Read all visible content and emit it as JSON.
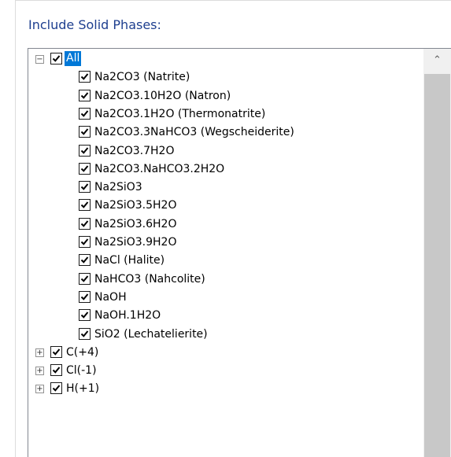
{
  "group": {
    "title": "Include Solid Phases:"
  },
  "tree": {
    "root": {
      "label": "All",
      "checked": true,
      "expanded": true,
      "selected": true
    },
    "children": [
      "Na2CO3 (Natrite)",
      "Na2CO3.10H2O (Natron)",
      "Na2CO3.1H2O (Thermonatrite)",
      "Na2CO3.3NaHCO3 (Wegscheiderite)",
      "Na2CO3.7H2O",
      "Na2CO3.NaHCO3.2H2O",
      "Na2SiO3",
      "Na2SiO3.5H2O",
      "Na2SiO3.6H2O",
      "Na2SiO3.9H2O",
      "NaCl (Halite)",
      "NaHCO3 (Nahcolite)",
      "NaOH",
      "NaOH.1H2O",
      "SiO2 (Lechatelierite)"
    ],
    "siblings": [
      "C(+4)",
      "Cl(-1)",
      "H(+1)"
    ]
  },
  "icons": {
    "collapse": "minus-box-icon",
    "expand": "plus-box-icon",
    "checkmark": "checkmark-icon",
    "scroll_up": "chevron-up-icon"
  },
  "colors": {
    "title": "#1e3f8f",
    "selection": "#0078d7",
    "scrollbar": "#f0f0f0",
    "thumb": "#c8c8c8"
  }
}
